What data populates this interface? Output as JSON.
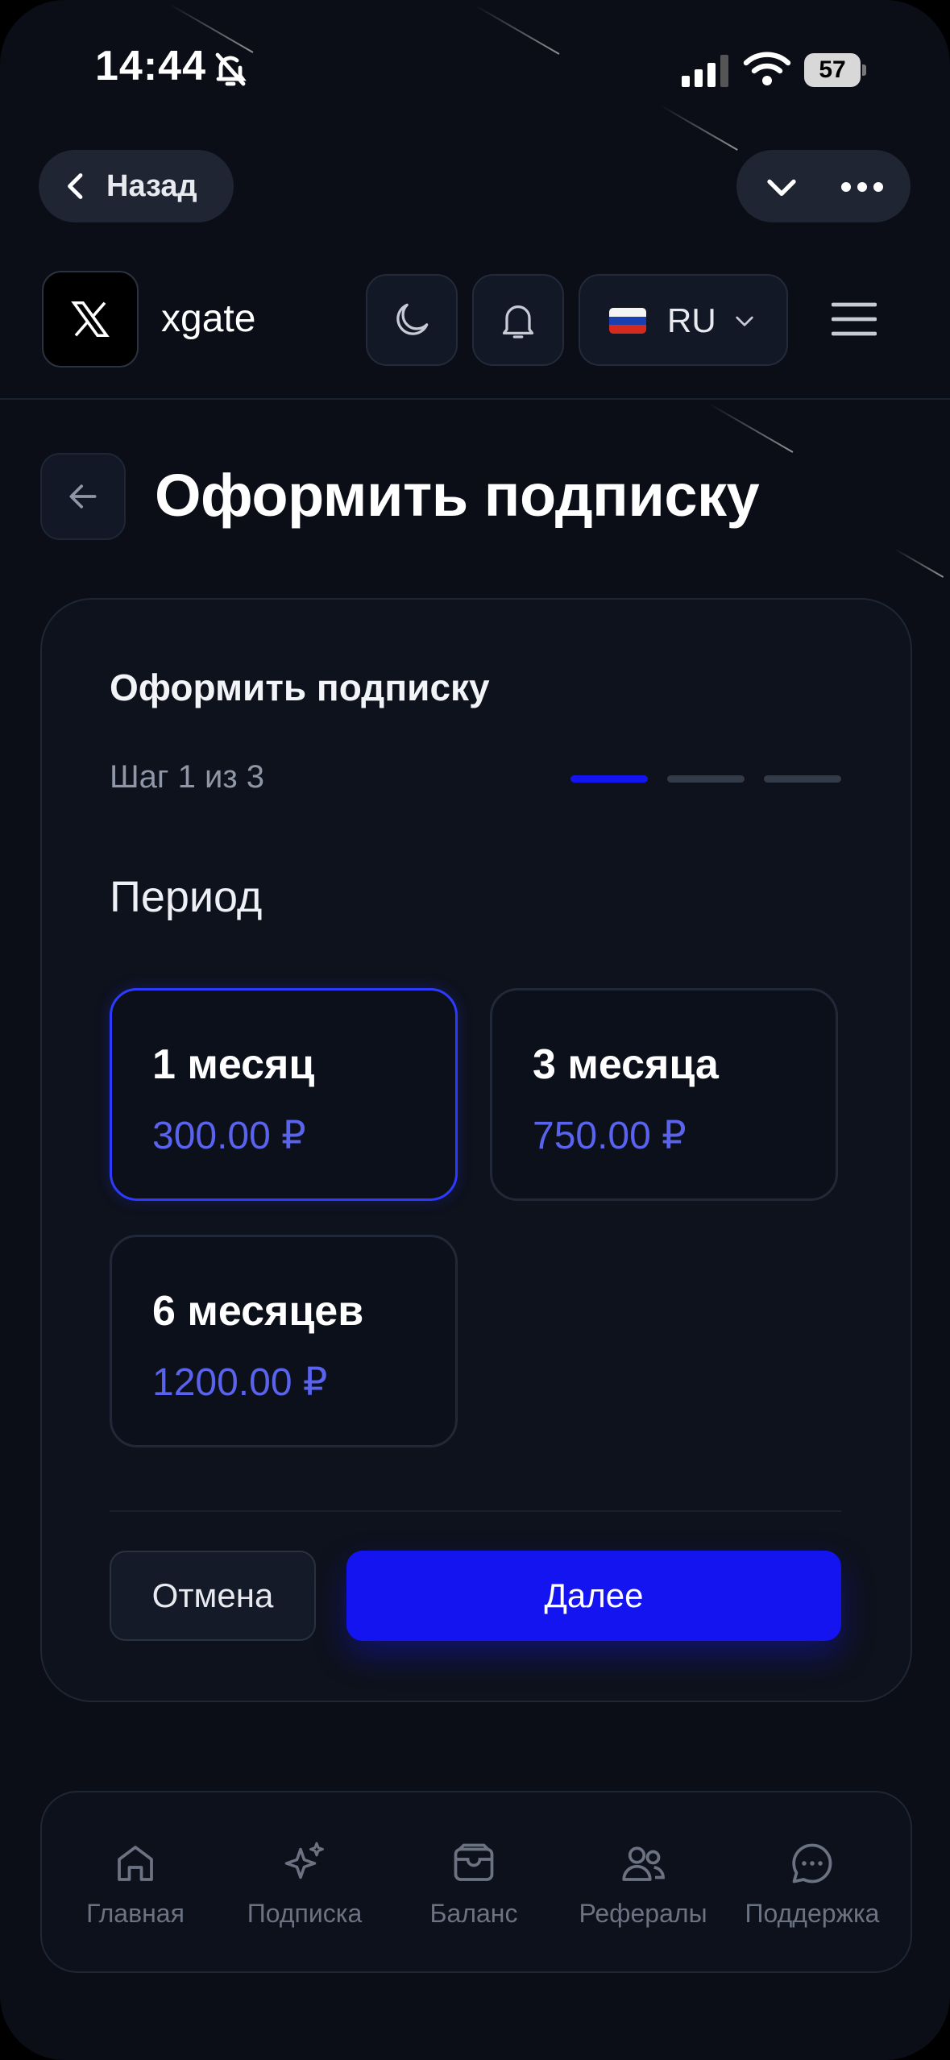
{
  "status_bar": {
    "time": "14:44",
    "battery": "57"
  },
  "browser": {
    "back_label": "Назад"
  },
  "header": {
    "brand": "xgate",
    "language": "RU"
  },
  "page": {
    "title": "Оформить подписку"
  },
  "card": {
    "title": "Оформить подписку",
    "step_text": "Шаг 1 из 3",
    "current_step": 1,
    "total_steps": 3,
    "section_label": "Период",
    "options": [
      {
        "label": "1 месяц",
        "price": "300.00 ₽",
        "selected": true
      },
      {
        "label": "3 месяца",
        "price": "750.00 ₽",
        "selected": false
      },
      {
        "label": "6 месяцев",
        "price": "1200.00 ₽",
        "selected": false
      }
    ],
    "cancel_label": "Отмена",
    "next_label": "Далее"
  },
  "bottom_nav": {
    "items": [
      {
        "label": "Главная",
        "icon": "home-icon"
      },
      {
        "label": "Подписка",
        "icon": "sparkles-icon"
      },
      {
        "label": "Баланс",
        "icon": "wallet-icon"
      },
      {
        "label": "Рефералы",
        "icon": "users-icon"
      },
      {
        "label": "Поддержка",
        "icon": "chat-icon"
      }
    ]
  },
  "colors": {
    "accent": "#1414f0",
    "price": "#5a63ee",
    "background": "#0b0e17",
    "step_inactive": "#343b48"
  }
}
